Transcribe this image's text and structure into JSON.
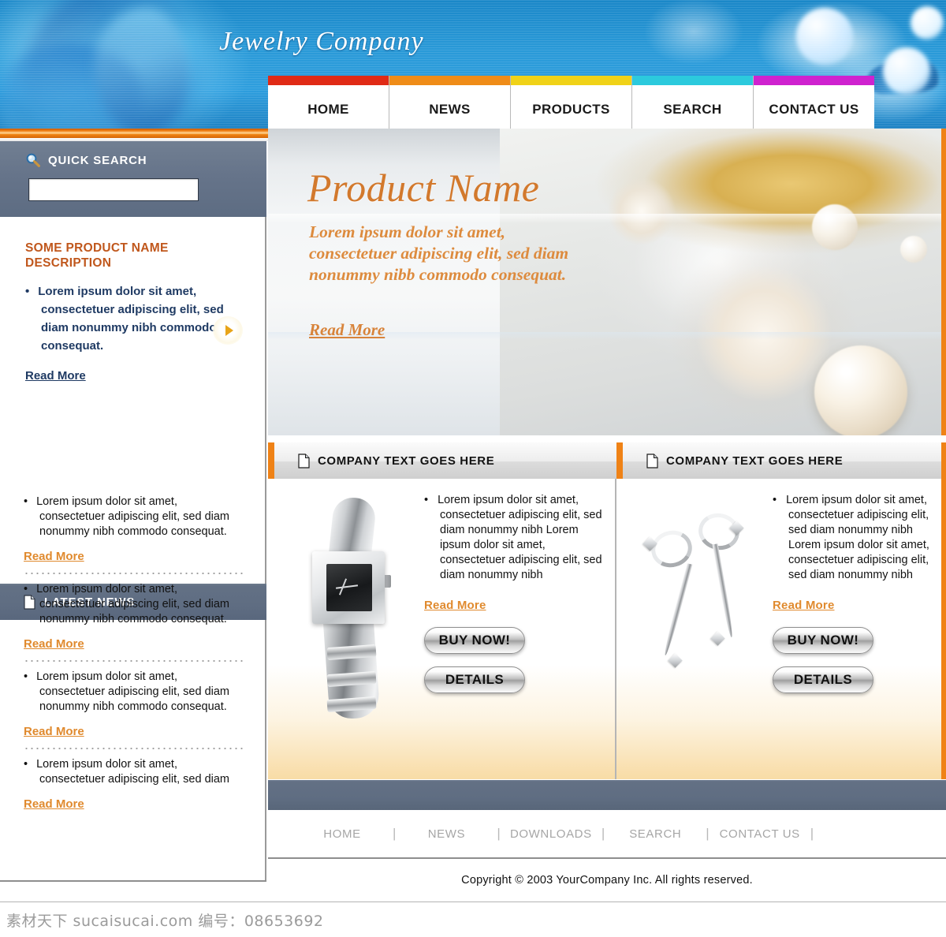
{
  "site": {
    "title": "Jewelry Company"
  },
  "nav": {
    "items": [
      {
        "label": "HOME",
        "color": "#e02b16"
      },
      {
        "label": "NEWS",
        "color": "#ef8c18"
      },
      {
        "label": "PRODUCTS",
        "color": "#f0d218"
      },
      {
        "label": "SEARCH",
        "color": "#2ccadd"
      },
      {
        "label": "CONTACT US",
        "color": "#cf22cf"
      }
    ]
  },
  "quick_search": {
    "label": "QUICK SEARCH",
    "icon": "search-icon",
    "input_value": "",
    "input_placeholder": "",
    "go_icon": "play-triangle-icon"
  },
  "sidebar": {
    "promo": {
      "heading": "SOME PRODUCT NAME DESCRIPTION",
      "bullets": [
        "Lorem ipsum dolor sit amet, consectetuer adipiscing elit, sed diam nonummy nibh commodo consequat."
      ],
      "read_more": "Read More"
    },
    "news_header": {
      "title": "LATEST NEWS",
      "icon": "document-icon"
    },
    "news_items": [
      {
        "text": "Lorem ipsum dolor sit amet, consectetuer adipiscing elit, sed diam nonummy nibh commodo consequat.",
        "read_more": "Read More"
      },
      {
        "text": "Lorem ipsum dolor sit amet, consectetuer adipiscing elit, sed diam nonummy nibh commodo consequat.",
        "read_more": "Read More"
      },
      {
        "text": "Lorem ipsum dolor sit amet, consectetuer adipiscing elit, sed diam nonummy nibh commodo consequat.",
        "read_more": "Read More"
      },
      {
        "text": "Lorem ipsum dolor sit amet, consectetuer adipiscing elit, sed diam",
        "read_more": "Read More"
      }
    ]
  },
  "hero": {
    "title": "Product Name",
    "body": "Lorem ipsum dolor sit amet, consectetuer adipiscing elit, sed diam nonummy nibb commodo consequat.",
    "read_more": "Read More",
    "image_alt": "pearl-and-gold-rings-photo"
  },
  "products": [
    {
      "header": "COMPANY TEXT GOES HERE",
      "header_icon": "document-icon",
      "image_alt": "silver-wristwatch-photo",
      "bullet": "Lorem ipsum dolor sit amet, consectetuer adipiscing elit, sed diam nonummy nibh  Lorem ipsum dolor sit amet, consectetuer adipiscing elit, sed diam nonummy nibh",
      "read_more": "Read More",
      "buy_label": "BUY NOW!",
      "details_label": "DETAILS"
    },
    {
      "header": "COMPANY TEXT GOES HERE",
      "header_icon": "document-icon",
      "image_alt": "silver-drop-earrings-photo",
      "bullet": "Lorem ipsum dolor sit amet, consectetuer adipiscing elit, sed diam nonummy nibh  Lorem ipsum dolor sit amet, consectetuer adipiscing elit, sed diam nonummy nibh",
      "read_more": "Read More",
      "buy_label": "BUY NOW!",
      "details_label": "DETAILS"
    }
  ],
  "footer": {
    "links": [
      "HOME",
      "NEWS",
      "DOWNLOADS",
      "SEARCH",
      "CONTACT US"
    ],
    "separator": "|",
    "copyright": "Copyright © 2003 YourCompany Inc. All rights reserved."
  },
  "watermark": {
    "text": "素材天下 sucaisucai.com 编号：08653692"
  },
  "colors": {
    "accent_orange": "#ef8216",
    "heading_rust": "#c0571c",
    "link_navy": "#1f3a63",
    "link_orange": "#e08a2e",
    "panel_slate": "#616f84",
    "banner_blue": "#2a9ad8"
  }
}
